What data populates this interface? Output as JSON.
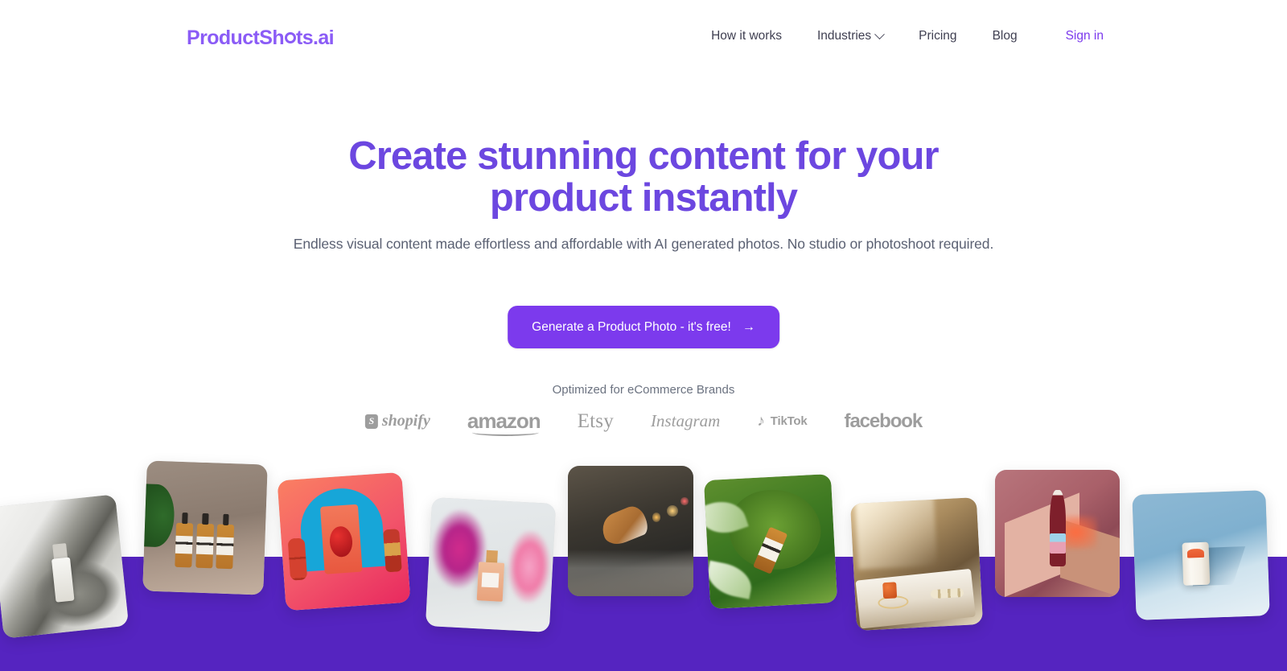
{
  "brand": {
    "logo_part1": "Product",
    "logo_part2": "Sh",
    "logo_part3": "ts.ai",
    "logo_color": "#8B5CF6"
  },
  "nav": {
    "items": [
      {
        "label": "How it works",
        "icon": ""
      },
      {
        "label": "Industries",
        "icon": "chevron-down-icon"
      },
      {
        "label": "Pricing",
        "icon": ""
      },
      {
        "label": "Blog",
        "icon": ""
      }
    ],
    "signin_label": "Sign in",
    "signin_color": "#7C3AED"
  },
  "hero": {
    "headline": "Create stunning content for your product instantly",
    "headline_color": "#6C47E0",
    "subheadline": "Endless visual content made effortless and affordable with AI generated photos. No studio or photoshoot required.",
    "cta_label": "Generate a Product Photo - it's free!",
    "cta_arrow": "→",
    "cta_bg": "#7C3AED",
    "optimized_label": "Optimized for eCommerce Brands"
  },
  "brands": [
    {
      "name": "shopify",
      "label": "shopify",
      "icon": "shopify-bag-icon"
    },
    {
      "name": "amazon",
      "label": "amazon",
      "icon": "amazon-smile-icon"
    },
    {
      "name": "etsy",
      "label": "Etsy",
      "icon": ""
    },
    {
      "name": "instagram",
      "label": "Instagram",
      "icon": ""
    },
    {
      "name": "tiktok",
      "label": "TikTok",
      "icon": "tiktok-note-icon"
    },
    {
      "name": "facebook",
      "label": "facebook",
      "icon": ""
    }
  ],
  "band": {
    "color": "#5524C0"
  },
  "gallery": {
    "cards": [
      {
        "alt": "serum-bottle-on-white-fabric"
      },
      {
        "alt": "three-amber-pump-bottles-with-plant"
      },
      {
        "alt": "red-pouch-snack-on-blue-arch"
      },
      {
        "alt": "perfume-bottle-with-pink-smoke"
      },
      {
        "alt": "sneaker-splashing-in-city-puddle"
      },
      {
        "alt": "amber-dropper-bottle-on-moss"
      },
      {
        "alt": "gemstone-ring-and-pearls-on-stone"
      },
      {
        "alt": "rose-wine-bottle-on-pink-backdrop"
      },
      {
        "alt": "olipop-vintage-cola-can-on-blue"
      }
    ]
  }
}
